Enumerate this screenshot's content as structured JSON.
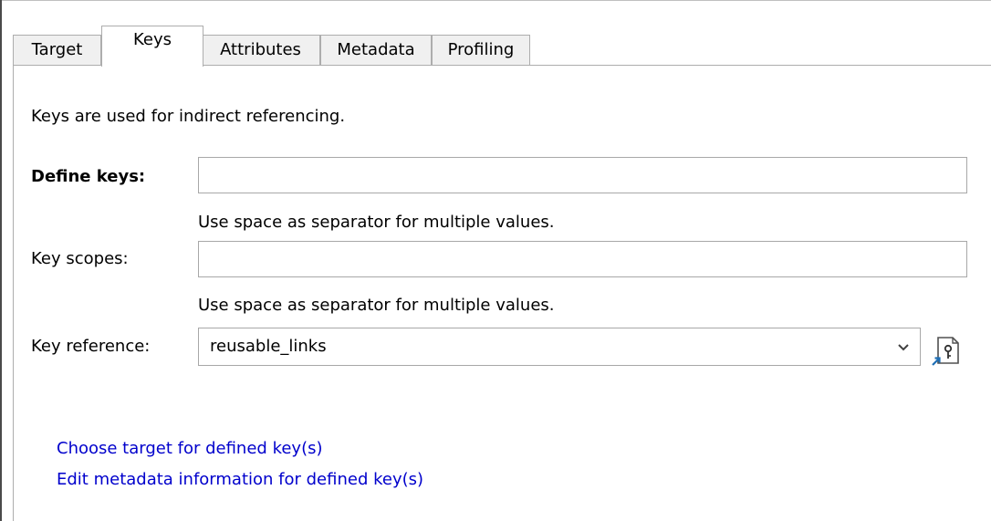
{
  "tabs": [
    {
      "label": "Target",
      "active": false
    },
    {
      "label": "Keys",
      "active": true
    },
    {
      "label": "Attributes",
      "active": false
    },
    {
      "label": "Metadata",
      "active": false
    },
    {
      "label": "Profiling",
      "active": false
    }
  ],
  "keys_panel": {
    "description": "Keys are used for indirect referencing.",
    "define_keys": {
      "label": "Define keys:",
      "value": "",
      "hint": "Use space as separator for multiple values."
    },
    "key_scopes": {
      "label": "Key scopes:",
      "value": "",
      "hint": "Use space as separator for multiple values."
    },
    "key_reference": {
      "label": "Key reference:",
      "selected": "reusable_links"
    },
    "links": {
      "choose_target": "Choose target for defined key(s)",
      "edit_metadata": "Edit metadata information for defined key(s)"
    }
  },
  "colors": {
    "link": "#0000cc",
    "border": "#adadad",
    "tab_inactive_bg": "#f0f0f0",
    "icon_accent": "#1f6fb5"
  },
  "icons": {
    "combo_arrow": "chevron-down-icon",
    "reference_button": "key-reference-icon"
  }
}
